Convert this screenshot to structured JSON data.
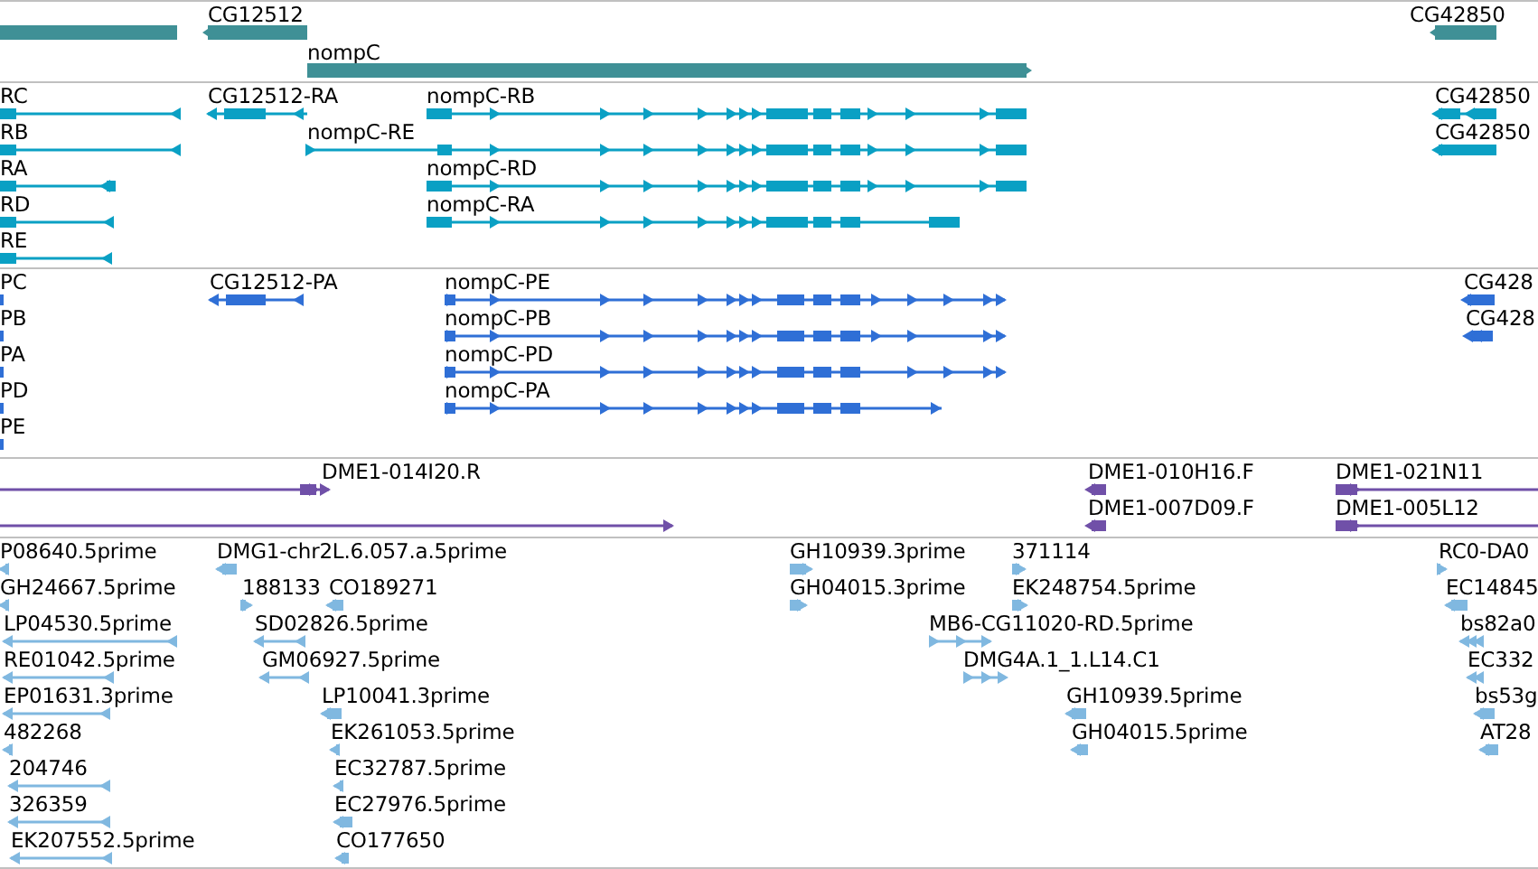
{
  "tracks": [
    {
      "kind": "gene",
      "features": [
        {
          "clipped": true
        },
        {
          "label": "CG12512",
          "reverse_strand": true
        },
        {
          "label": "nompC",
          "reverse_strand": false
        },
        {
          "label": "CG42850",
          "reverse_strand": true
        }
      ]
    },
    {
      "kind": "transcript",
      "features": [
        {
          "label": "RC",
          "reverse_strand": true
        },
        {
          "label": "RB",
          "reverse_strand": true
        },
        {
          "label": "RA",
          "reverse_strand": true
        },
        {
          "label": "RD",
          "reverse_strand": true
        },
        {
          "label": "RE",
          "reverse_strand": true
        },
        {
          "label": "CG12512-RA",
          "reverse_strand": true
        },
        {
          "label": "nompC-RB",
          "reverse_strand": false
        },
        {
          "label": "nompC-RE",
          "reverse_strand": false
        },
        {
          "label": "nompC-RD",
          "reverse_strand": false
        },
        {
          "label": "nompC-RA",
          "reverse_strand": false
        },
        {
          "label": "CG42850",
          "reverse_strand": true
        },
        {
          "label": "CG42850",
          "reverse_strand": true
        }
      ]
    },
    {
      "kind": "protein",
      "features": [
        {
          "label": "PC"
        },
        {
          "label": "PB"
        },
        {
          "label": "PA"
        },
        {
          "label": "PD"
        },
        {
          "label": "PE"
        },
        {
          "label": "CG12512-PA",
          "reverse_strand": true
        },
        {
          "label": "nompC-PE",
          "reverse_strand": false
        },
        {
          "label": "nompC-PB",
          "reverse_strand": false
        },
        {
          "label": "nompC-PD",
          "reverse_strand": false
        },
        {
          "label": "nompC-PA",
          "reverse_strand": false
        },
        {
          "label": "CG428",
          "reverse_strand": true
        },
        {
          "label": "CG428",
          "reverse_strand": true
        }
      ]
    },
    {
      "kind": "clone",
      "features": [
        {
          "reverse_strand": false
        },
        {
          "reverse_strand": false
        },
        {
          "label": "DME1-014I20.R",
          "reverse_strand": false
        },
        {
          "label": "DME1-010H16.F",
          "reverse_strand": true
        },
        {
          "label": "DME1-007D09.F",
          "reverse_strand": true
        },
        {
          "label": "DME1-021N11",
          "reverse_strand": false
        },
        {
          "label": "DME1-005L12",
          "reverse_strand": false
        }
      ]
    },
    {
      "kind": "est",
      "features": [
        {
          "label": "P08640.5prime",
          "reverse_strand": true
        },
        {
          "label": "GH24667.5prime",
          "reverse_strand": true
        },
        {
          "label": "LP04530.5prime",
          "reverse_strand": true
        },
        {
          "label": "RE01042.5prime",
          "reverse_strand": true
        },
        {
          "label": "EP01631.3prime",
          "reverse_strand": true
        },
        {
          "label": "482268",
          "reverse_strand": true
        },
        {
          "label": "204746",
          "reverse_strand": true
        },
        {
          "label": "326359",
          "reverse_strand": true
        },
        {
          "label": "EK207552.5prime",
          "reverse_strand": true
        },
        {
          "label": "DMG1-chr2L.6.057.a.5prime",
          "reverse_strand": true
        },
        {
          "label": "188133",
          "reverse_strand": false
        },
        {
          "label": "CO189271",
          "reverse_strand": true
        },
        {
          "label": "SD02826.5prime",
          "reverse_strand": true
        },
        {
          "label": "GM06927.5prime",
          "reverse_strand": true
        },
        {
          "label": "LP10041.3prime",
          "reverse_strand": true
        },
        {
          "label": "EK261053.5prime",
          "reverse_strand": true
        },
        {
          "label": "EC32787.5prime",
          "reverse_strand": true
        },
        {
          "label": "EC27976.5prime",
          "reverse_strand": true
        },
        {
          "label": "CO177650",
          "reverse_strand": true
        },
        {
          "label": "GH10939.3prime",
          "reverse_strand": false
        },
        {
          "label": "GH04015.3prime",
          "reverse_strand": false
        },
        {
          "label": "371114",
          "reverse_strand": false
        },
        {
          "label": "EK248754.5prime",
          "reverse_strand": false
        },
        {
          "label": "MB6-CG11020-RD.5prime",
          "reverse_strand": false
        },
        {
          "label": "DMG4A.1_1.L14.C1",
          "reverse_strand": false
        },
        {
          "label": "GH10939.5prime",
          "reverse_strand": true
        },
        {
          "label": "GH04015.5prime",
          "reverse_strand": true
        },
        {
          "label": "RC0-DA0",
          "reverse_strand": false
        },
        {
          "label": "EC14845",
          "reverse_strand": true
        },
        {
          "label": "bs82a0",
          "reverse_strand": true
        },
        {
          "label": "EC332",
          "reverse_strand": true
        },
        {
          "label": "bs53g",
          "reverse_strand": true
        },
        {
          "label": "AT28",
          "reverse_strand": true
        }
      ]
    }
  ]
}
